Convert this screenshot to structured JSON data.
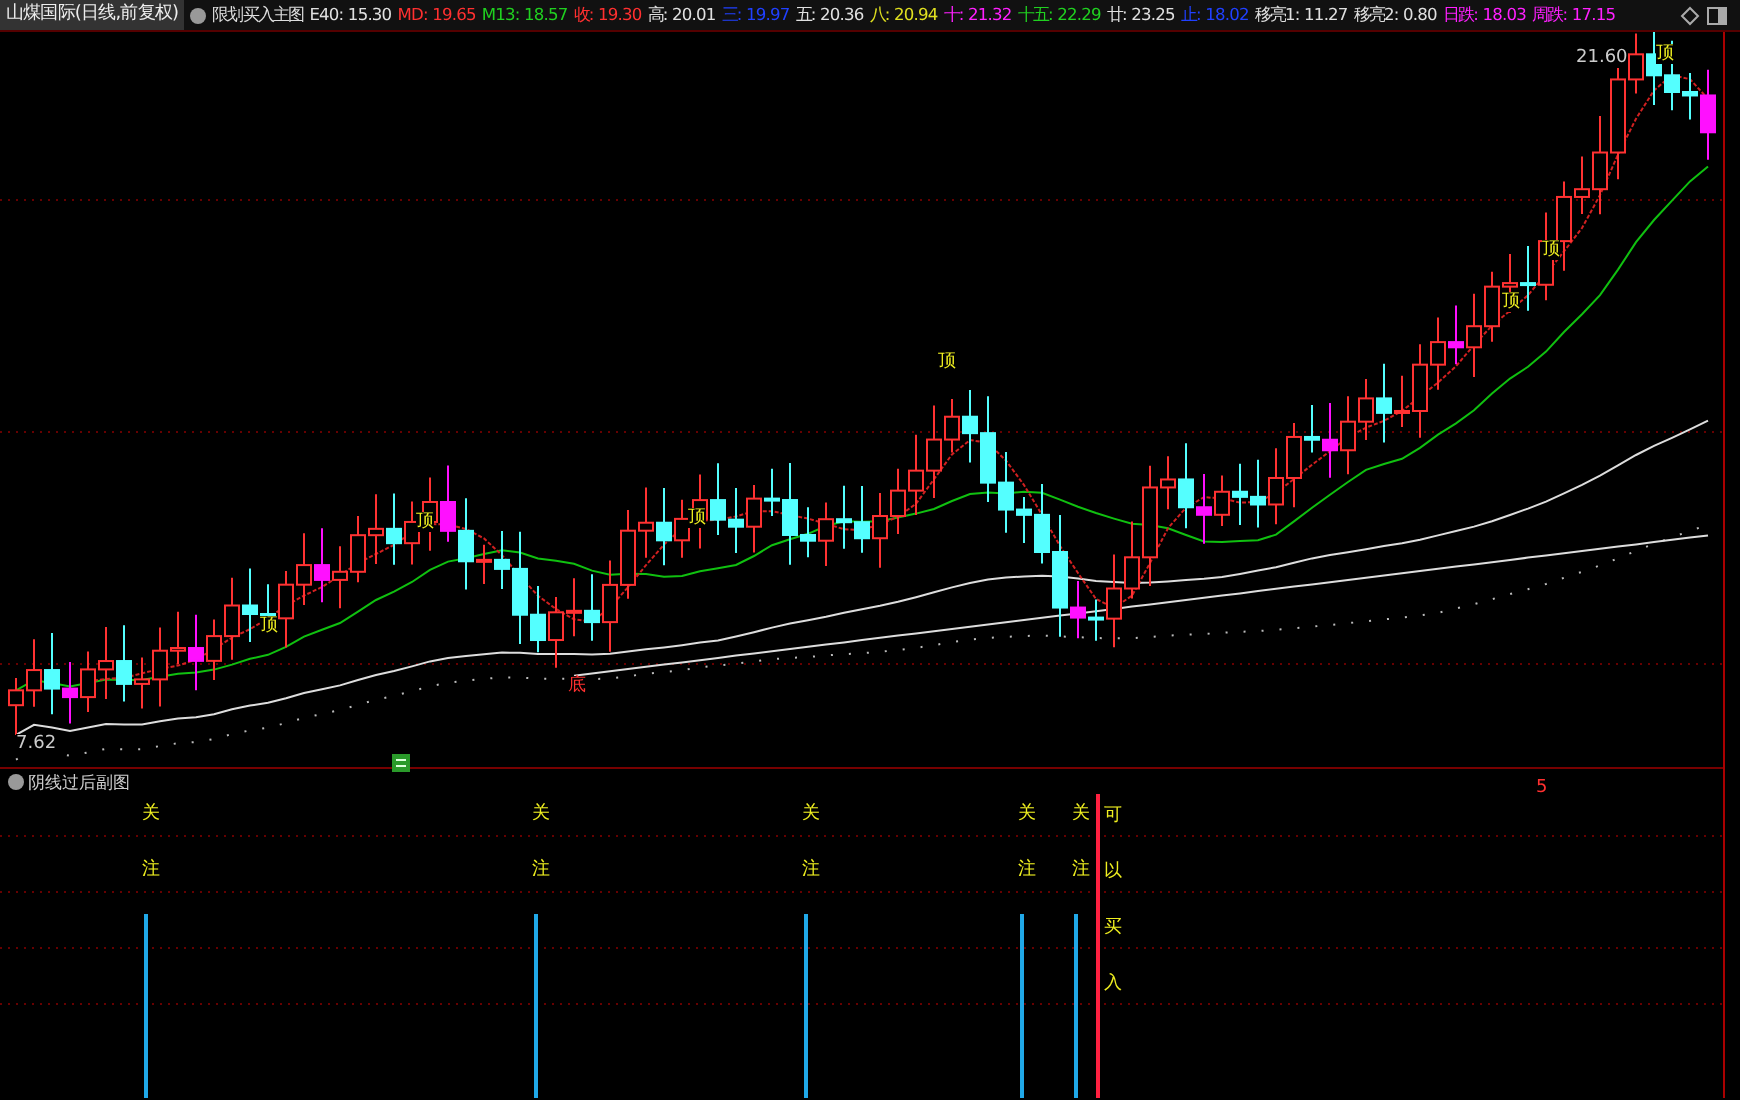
{
  "header": {
    "title": "山煤国际(日线,前复权)",
    "indicator": "限划买入主图",
    "legend": [
      {
        "text": "E40: 15.30",
        "color": "#e0e0e0"
      },
      {
        "text": "MD: 19.65",
        "color": "#ff3030"
      },
      {
        "text": "M13: 18.57",
        "color": "#20d020"
      },
      {
        "text": "收: 19.30",
        "color": "#ff3030"
      },
      {
        "text": "高: 20.01",
        "color": "#e0e0e0"
      },
      {
        "text": "三: 19.97",
        "color": "#2040ff"
      },
      {
        "text": "五: 20.36",
        "color": "#e0e0e0"
      },
      {
        "text": "八: 20.94",
        "color": "#e0e020"
      },
      {
        "text": "十: 21.32",
        "color": "#ff20ff"
      },
      {
        "text": "十五: 22.29",
        "color": "#20d020"
      },
      {
        "text": "廿: 23.25",
        "color": "#e0e0e0"
      },
      {
        "text": "止: 18.02",
        "color": "#2040ff"
      },
      {
        "text": "移亮1: 11.27",
        "color": "#e0e0e0"
      },
      {
        "text": "移亮2: 0.80",
        "color": "#e0e0e0"
      },
      {
        "text": "日跌: 18.03",
        "color": "#ff20ff"
      },
      {
        "text": "周跌: 17.15",
        "color": "#ff20ff"
      }
    ]
  },
  "chart": {
    "markers": [
      {
        "text": "顶"
      },
      {
        "text": "顶"
      },
      {
        "text": "顶"
      },
      {
        "text": "顶"
      },
      {
        "text": "顶"
      },
      {
        "text": "顶"
      },
      {
        "text": "顶"
      },
      {
        "text": "底"
      },
      {
        "text": "5"
      }
    ],
    "high_label": "21.60",
    "low_label": "7.62"
  },
  "sub_panel": {
    "title": "阴线过后副图",
    "signals": [
      {
        "top": "关",
        "bottom": "注"
      },
      {
        "top": "关",
        "bottom": "注"
      },
      {
        "top": "关",
        "bottom": "注"
      },
      {
        "top": "关",
        "bottom": "注"
      },
      {
        "top": "关",
        "bottom": "注"
      }
    ],
    "buy_text": "可以买入"
  }
}
